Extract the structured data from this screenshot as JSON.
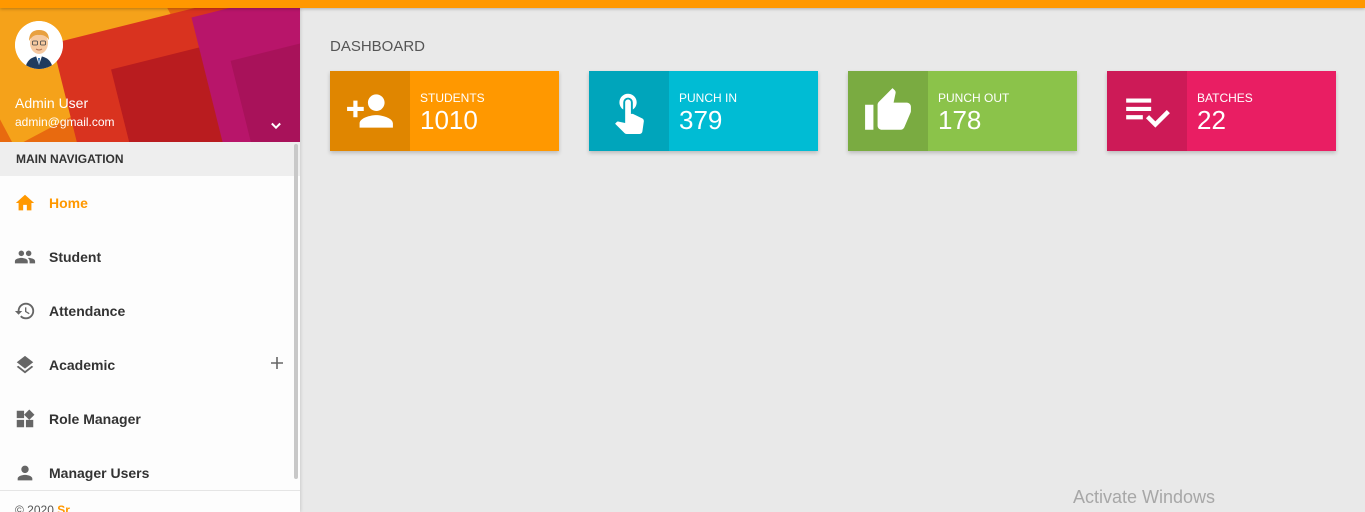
{
  "colors": {
    "accent": "#ff9800",
    "students": "#ff9800",
    "students_dark": "#e08600",
    "punch_in": "#00bcd4",
    "punch_in_dark": "#00a5bb",
    "punch_out": "#8bc34a",
    "punch_out_dark": "#7aab41",
    "batches": "#e91e63",
    "batches_dark": "#cd1a57"
  },
  "user": {
    "name": "Admin User",
    "email": "admin@gmail.com"
  },
  "sidebar": {
    "header": "MAIN NAVIGATION",
    "items": [
      {
        "label": "Home",
        "icon": "home-icon"
      },
      {
        "label": "Student",
        "icon": "people-icon"
      },
      {
        "label": "Attendance",
        "icon": "history-icon"
      },
      {
        "label": "Academic",
        "icon": "layers-icon"
      },
      {
        "label": "Role Manager",
        "icon": "widgets-icon"
      },
      {
        "label": "Manager Users",
        "icon": "person-icon"
      }
    ],
    "footer_prefix": "© 2020",
    "footer_brand": "Sr..."
  },
  "main": {
    "title": "DASHBOARD",
    "cards": [
      {
        "label": "STUDENTS",
        "value": "1010",
        "icon": "person-add-icon"
      },
      {
        "label": "PUNCH IN",
        "value": "379",
        "icon": "touch-icon"
      },
      {
        "label": "PUNCH OUT",
        "value": "178",
        "icon": "thumb-up-icon"
      },
      {
        "label": "BATCHES",
        "value": "22",
        "icon": "playlist-check-icon"
      }
    ]
  },
  "watermark": "Activate Windows"
}
